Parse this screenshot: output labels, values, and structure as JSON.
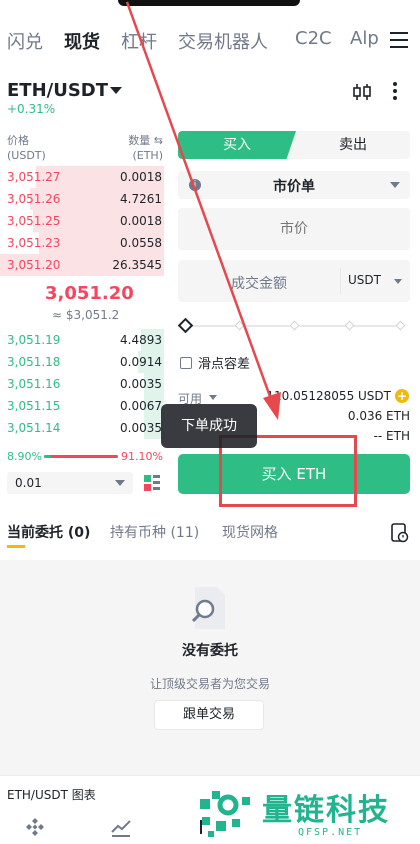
{
  "nav": {
    "tabs": [
      "闪兑",
      "现货",
      "杠杆",
      "交易机器人",
      "C2C",
      "Alp"
    ],
    "active_index": 1
  },
  "pair": {
    "symbol": "ETH/USDT",
    "change": "+0.31%"
  },
  "orderbook": {
    "price_header": "价格",
    "price_unit": "(USDT)",
    "qty_header": "数量 ⇆",
    "qty_unit": "(ETH)",
    "asks": [
      {
        "price": "3,051.27",
        "qty": "0.0018",
        "depth": 0.78
      },
      {
        "price": "3,051.26",
        "qty": "4.7261",
        "depth": 0.82
      },
      {
        "price": "3,051.25",
        "qty": "0.0018",
        "depth": 0.8
      },
      {
        "price": "3,051.23",
        "qty": "0.0558",
        "depth": 0.76
      },
      {
        "price": "3,051.20",
        "qty": "26.3545",
        "depth": 1.0
      }
    ],
    "last_price": "3,051.20",
    "last_price_usd": "≈ $3,051.2",
    "bids": [
      {
        "price": "3,051.19",
        "qty": "4.4893",
        "depth": 0.14
      },
      {
        "price": "3,051.18",
        "qty": "0.0914",
        "depth": 0.16
      },
      {
        "price": "3,051.16",
        "qty": "0.0035",
        "depth": 0.12
      },
      {
        "price": "3,051.15",
        "qty": "0.0067",
        "depth": 0.12
      },
      {
        "price": "3,051.14",
        "qty": "0.0035",
        "depth": 0.12
      }
    ],
    "buy_ratio": "8.90%",
    "sell_ratio": "91.10%",
    "buy_ratio_value": 0.089,
    "precision": "0.01"
  },
  "trade": {
    "buy_label": "买入",
    "sell_label": "卖出",
    "order_type": "市价单",
    "price_placeholder": "市价",
    "amount_placeholder": "成交金额",
    "amount_unit": "USDT",
    "slippage_label": "滑点容差",
    "available_label": "可用",
    "available_value": "110.05128055 USDT",
    "max_buy": "0.036 ETH",
    "fee": "-- ETH",
    "submit_label": "买入 ETH",
    "toast": "下单成功"
  },
  "orders": {
    "tabs": [
      "当前委托 (0)",
      "持有币种 (11)",
      "现货网格"
    ],
    "empty_title": "没有委托",
    "empty_sub": "让顶级交易者为您交易",
    "copy_button": "跟单交易"
  },
  "chart_strip": {
    "label": "ETH/USDT 图表"
  },
  "watermark": {
    "name": "量链科技",
    "domain": "QFSP.NET"
  },
  "colors": {
    "green": "#2ebd85",
    "red": "#f6465d",
    "yellow": "#f0b90b",
    "annotation": "#e5484d"
  }
}
